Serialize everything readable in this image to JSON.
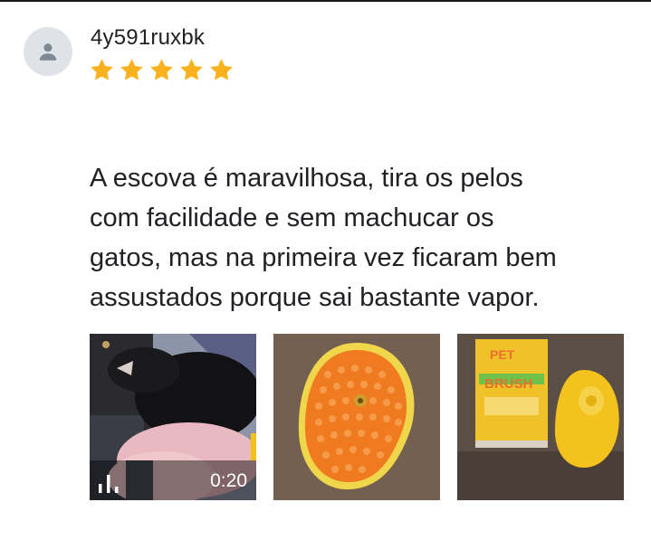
{
  "review": {
    "username": "4y591ruxbk",
    "rating": 5,
    "max_rating": 5,
    "star_color": "#f9b21d",
    "text_lines": [
      "A escova é maravilhosa, tira os pelos",
      "com facilidade e sem machucar os",
      "gatos, mas na primeira vez ficaram bem",
      "assustados porque sai bastante vapor."
    ]
  },
  "media": [
    {
      "kind": "video",
      "subject": "cat being brushed",
      "duration": "0:20",
      "icon": "video-bars-icon"
    },
    {
      "kind": "photo",
      "subject": "orange pet brush"
    },
    {
      "kind": "photo",
      "subject": "yellow pet brush with box"
    }
  ],
  "photo_box_text": {
    "line1": "PET",
    "line2": "BRUSH"
  }
}
